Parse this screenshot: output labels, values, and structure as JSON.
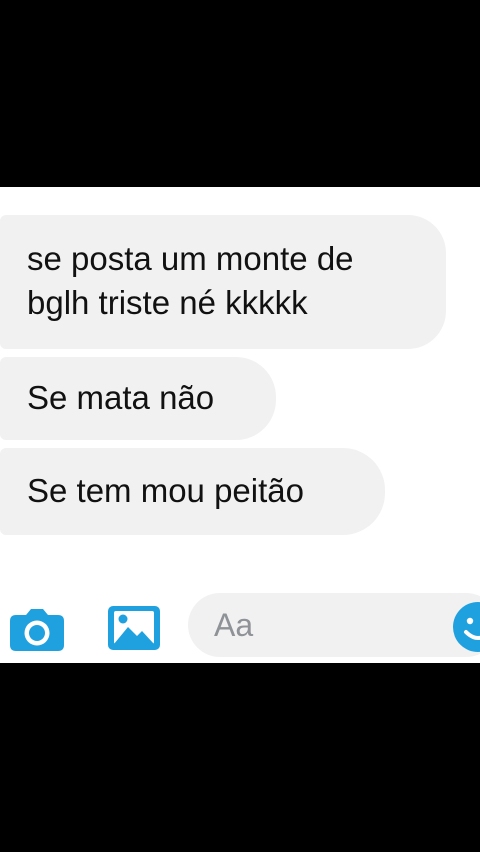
{
  "messages": [
    {
      "text": "se posta um monte de\nbglh triste né kkkkk"
    },
    {
      "text": "Se mata não"
    },
    {
      "text": "Se tem mou peitão"
    }
  ],
  "composer": {
    "placeholder": "Aa",
    "icons": [
      "camera-icon",
      "image-icon",
      "emoji-icon"
    ]
  },
  "colors": {
    "background": "#000000",
    "chat_background": "#ffffff",
    "bubble": "#f1f1f2",
    "accent": "#1fa1df"
  }
}
